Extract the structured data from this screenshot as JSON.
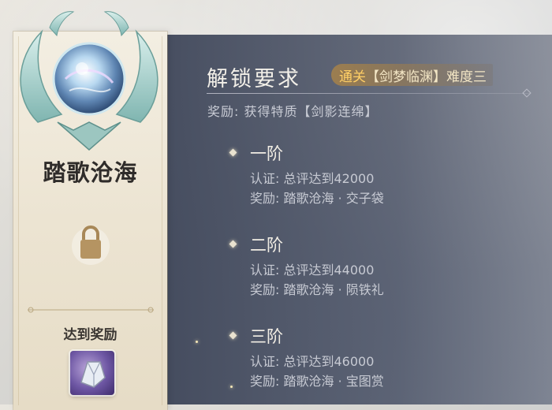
{
  "title": "踏歌沧海",
  "panel": {
    "heading": "解锁要求",
    "requirement": {
      "prefix": "通关",
      "stage": "【剑梦临渊】",
      "difficulty": "难度三"
    },
    "reward_line": "奖励: 获得特质【剑影连绵】"
  },
  "tiers": [
    {
      "name": "一阶",
      "cert": "认证: 总评达到42000",
      "reward": "奖励: 踏歌沧海 · 交子袋"
    },
    {
      "name": "二阶",
      "cert": "认证: 总评达到44000",
      "reward": "奖励: 踏歌沧海 · 陨铁礼"
    },
    {
      "name": "三阶",
      "cert": "认证: 总评达到46000",
      "reward": "奖励: 踏歌沧海 · 宝图赏"
    }
  ],
  "left": {
    "lock_icon": "padlock-icon",
    "reward_label": "达到奖励",
    "reward_item_icon": "silver-ingot-icon"
  },
  "colors": {
    "accent_gold": "#ffcf66",
    "panel_bg": "#3a4256"
  }
}
